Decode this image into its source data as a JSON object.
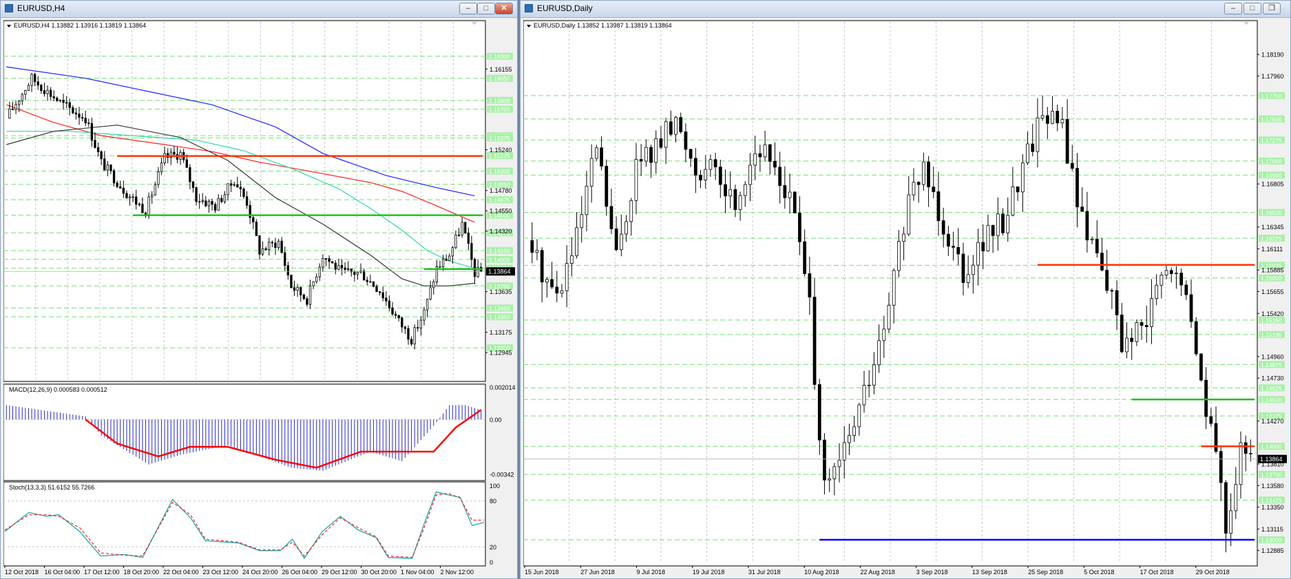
{
  "window_left": {
    "title": "EURUSD,H4"
  },
  "window_right": {
    "title": "EURUSD,Daily"
  },
  "chart_data": [
    {
      "type": "candlestick",
      "symbol_info": "EURUSD,H4  1.13882 1.13916 1.13819 1.13864",
      "ylim": [
        1.1265,
        1.165
      ],
      "y_axis_labels": [
        "1.16155",
        "1.15240",
        "1.14780",
        "1.14550",
        "1.14320",
        "1.13635",
        "1.13175",
        "1.12945"
      ],
      "green_levels": [
        "1.16300",
        "1.16050",
        "1.15800",
        "1.15700",
        "1.15400",
        "1.15375",
        "1.15175",
        "1.15000",
        "1.14850",
        "1.14675",
        "1.14500",
        "1.14300",
        "1.14100",
        "1.14000",
        "1.13900",
        "1.13700",
        "1.13450",
        "1.13350",
        "1.13000"
      ],
      "current_price_label": "1.13864",
      "current_price": 1.13864,
      "x_tick_labels": [
        "12 Oct 2018",
        "16 Oct 04:00",
        "17 Oct 12:00",
        "18 Oct 20:00",
        "22 Oct 04:00",
        "23 Oct 12:00",
        "24 Oct 20:00",
        "26 Oct 04:00",
        "29 Oct 12:00",
        "30 Oct 20:00",
        "1 Nov 04:00",
        "2 Nov 12:00"
      ],
      "support_resistance": [
        {
          "price": 1.1517,
          "color": "#ff3300",
          "from_idx": 35,
          "to_idx": 155
        },
        {
          "price": 1.145,
          "color": "#20c020",
          "from_idx": 40,
          "to_idx": 155
        },
        {
          "price": 1.1389,
          "color": "#20c020",
          "from_idx": 132,
          "to_idx": 155
        }
      ],
      "moving_averages": [
        {
          "color": "#2020ff",
          "points": [
            [
              0,
              1.1618
            ],
            [
              25,
              1.1605
            ],
            [
              45,
              1.159
            ],
            [
              65,
              1.1575
            ],
            [
              85,
              1.155
            ],
            [
              100,
              1.152
            ],
            [
              120,
              1.1495
            ],
            [
              135,
              1.1482
            ],
            [
              148,
              1.1472
            ]
          ]
        },
        {
          "color": "#ff2020",
          "points": [
            [
              0,
              1.1575
            ],
            [
              15,
              1.1555
            ],
            [
              30,
              1.154
            ],
            [
              50,
              1.153
            ],
            [
              65,
              1.1522
            ],
            [
              80,
              1.151
            ],
            [
              100,
              1.1497
            ],
            [
              115,
              1.1487
            ],
            [
              125,
              1.1477
            ],
            [
              135,
              1.1462
            ],
            [
              148,
              1.1442
            ]
          ]
        },
        {
          "color": "#30d8a8",
          "points": [
            [
              0,
              1.1545
            ],
            [
              20,
              1.1545
            ],
            [
              40,
              1.154
            ],
            [
              60,
              1.1535
            ],
            [
              75,
              1.1523
            ],
            [
              90,
              1.1503
            ],
            [
              105,
              1.148
            ],
            [
              115,
              1.1458
            ],
            [
              125,
              1.1433
            ],
            [
              133,
              1.141
            ],
            [
              140,
              1.1398
            ],
            [
              148,
              1.139
            ]
          ]
        },
        {
          "color": "#333333",
          "points": [
            [
              0,
              1.153
            ],
            [
              15,
              1.1545
            ],
            [
              35,
              1.1552
            ],
            [
              55,
              1.1538
            ],
            [
              70,
              1.1512
            ],
            [
              85,
              1.147
            ],
            [
              100,
              1.144
            ],
            [
              115,
              1.1405
            ],
            [
              125,
              1.1378
            ],
            [
              132,
              1.137
            ],
            [
              140,
              1.137
            ],
            [
              148,
              1.1373
            ]
          ]
        }
      ],
      "candle_anchors": [
        [
          0,
          1.156
        ],
        [
          8,
          1.1605
        ],
        [
          18,
          1.1575
        ],
        [
          25,
          1.156
        ],
        [
          30,
          1.151
        ],
        [
          38,
          1.1475
        ],
        [
          44,
          1.1455
        ],
        [
          50,
          1.1515
        ],
        [
          55,
          1.152
        ],
        [
          60,
          1.147
        ],
        [
          66,
          1.146
        ],
        [
          72,
          1.149
        ],
        [
          76,
          1.1465
        ],
        [
          80,
          1.141
        ],
        [
          86,
          1.142
        ],
        [
          90,
          1.137
        ],
        [
          95,
          1.1355
        ],
        [
          100,
          1.1405
        ],
        [
          106,
          1.1385
        ],
        [
          112,
          1.1385
        ],
        [
          118,
          1.1365
        ],
        [
          124,
          1.133
        ],
        [
          128,
          1.131
        ],
        [
          132,
          1.134
        ],
        [
          136,
          1.139
        ],
        [
          140,
          1.1405
        ],
        [
          144,
          1.144
        ],
        [
          148,
          1.1385
        ],
        [
          150,
          1.1386
        ]
      ],
      "macd": {
        "label": "MACD(12,26,9) 0.000583 0.000512",
        "ylim": [
          -0.0038,
          0.0022
        ],
        "axis_labels": [
          "0.002014",
          "0.00",
          "-0.00342"
        ],
        "hist_anchors": [
          [
            0,
            0.0009
          ],
          [
            25,
            0.0002
          ],
          [
            30,
            -0.001
          ],
          [
            45,
            -0.0028
          ],
          [
            55,
            -0.0022
          ],
          [
            70,
            -0.0016
          ],
          [
            90,
            -0.003
          ],
          [
            100,
            -0.0032
          ],
          [
            115,
            -0.002
          ],
          [
            125,
            -0.0026
          ],
          [
            135,
            -0.0004
          ],
          [
            140,
            0.0009
          ],
          [
            145,
            0.0009
          ],
          [
            150,
            0.0006
          ]
        ],
        "signal_anchors": [
          [
            25,
            0.0
          ],
          [
            35,
            -0.0015
          ],
          [
            48,
            -0.0023
          ],
          [
            58,
            -0.0017
          ],
          [
            70,
            -0.0017
          ],
          [
            85,
            -0.0025
          ],
          [
            98,
            -0.003
          ],
          [
            112,
            -0.002
          ],
          [
            125,
            -0.002
          ],
          [
            135,
            -0.002
          ],
          [
            142,
            -0.0005
          ],
          [
            150,
            0.0006
          ]
        ]
      },
      "stoch": {
        "label": "Stoch(13,3,3) 51.6152 55.7266",
        "ylim": [
          -5,
          105
        ],
        "axis_labels": [
          "100",
          "80",
          "20",
          "0"
        ],
        "main_anchors": [
          [
            0,
            40
          ],
          [
            8,
            65
          ],
          [
            14,
            60
          ],
          [
            18,
            62
          ],
          [
            25,
            40
          ],
          [
            32,
            8
          ],
          [
            40,
            10
          ],
          [
            46,
            6
          ],
          [
            56,
            82
          ],
          [
            62,
            58
          ],
          [
            67,
            28
          ],
          [
            78,
            25
          ],
          [
            85,
            15
          ],
          [
            92,
            15
          ],
          [
            96,
            30
          ],
          [
            100,
            5
          ],
          [
            106,
            40
          ],
          [
            112,
            60
          ],
          [
            118,
            42
          ],
          [
            124,
            32
          ],
          [
            128,
            6
          ],
          [
            136,
            5
          ],
          [
            140,
            50
          ],
          [
            144,
            92
          ],
          [
            148,
            88
          ],
          [
            152,
            85
          ],
          [
            156,
            48
          ],
          [
            160,
            52
          ]
        ],
        "signal_anchors": [
          [
            0,
            42
          ],
          [
            8,
            62
          ],
          [
            14,
            62
          ],
          [
            18,
            60
          ],
          [
            25,
            45
          ],
          [
            32,
            12
          ],
          [
            40,
            9
          ],
          [
            46,
            8
          ],
          [
            56,
            78
          ],
          [
            62,
            62
          ],
          [
            67,
            30
          ],
          [
            78,
            26
          ],
          [
            85,
            16
          ],
          [
            92,
            16
          ],
          [
            96,
            26
          ],
          [
            100,
            8
          ],
          [
            106,
            36
          ],
          [
            112,
            58
          ],
          [
            118,
            45
          ],
          [
            124,
            33
          ],
          [
            128,
            8
          ],
          [
            136,
            6
          ],
          [
            140,
            45
          ],
          [
            144,
            88
          ],
          [
            148,
            90
          ],
          [
            152,
            84
          ],
          [
            156,
            55
          ],
          [
            160,
            55
          ]
        ]
      }
    },
    {
      "type": "candlestick",
      "symbol_info": "EURUSD,Daily  1.13852 1.13987 1.13819 1.13864",
      "ylim": [
        1.1275,
        1.1836
      ],
      "y_axis_labels": [
        "1.18190",
        "1.17960",
        "1.16805",
        "1.16345",
        "1.16111",
        "1.15885",
        "1.15655",
        "1.15420",
        "1.14960",
        "1.14730",
        "1.14270",
        "1.13810",
        "1.13580",
        "1.13350",
        "1.13115",
        "1.12885"
      ],
      "green_levels": [
        "1.17750",
        "1.17500",
        "1.17275",
        "1.17050",
        "1.16900",
        "1.16500",
        "1.16225",
        "1.15935",
        "1.15800",
        "1.15350",
        "1.15195",
        "1.14875",
        "1.14625",
        "1.14500",
        "1.14325",
        "1.14000",
        "1.13700",
        "1.13425",
        "1.13000"
      ],
      "current_price_label": "1.13864",
      "current_price": 1.13864,
      "x_tick_labels": [
        "15 Jun 2018",
        "27 Jun 2018",
        "9 Jul 2018",
        "19 Jul 2018",
        "31 Jul 2018",
        "10 Aug 2018",
        "22 Aug 2018",
        "3 Sep 2018",
        "13 Sep 2018",
        "25 Sep 2018",
        "5 Oct 2018",
        "17 Oct 2018",
        "29 Oct 2018"
      ],
      "support_resistance": [
        {
          "price": 1.1594,
          "color": "#ff3300",
          "from_idx": 103,
          "to_idx": 148
        },
        {
          "price": 1.145,
          "color": "#20c020",
          "from_idx": 122,
          "to_idx": 148
        },
        {
          "price": 1.14,
          "color": "#ff3300",
          "from_idx": 136,
          "to_idx": 148
        },
        {
          "price": 1.13,
          "color": "#0000ff",
          "from_idx": 59,
          "to_idx": 148
        }
      ],
      "candle_anchors": [
        [
          0,
          1.162
        ],
        [
          6,
          1.156
        ],
        [
          10,
          1.162
        ],
        [
          14,
          1.172
        ],
        [
          18,
          1.16
        ],
        [
          22,
          1.17
        ],
        [
          26,
          1.172
        ],
        [
          30,
          1.1745
        ],
        [
          34,
          1.17
        ],
        [
          38,
          1.169
        ],
        [
          42,
          1.166
        ],
        [
          46,
          1.172
        ],
        [
          50,
          1.17
        ],
        [
          54,
          1.165
        ],
        [
          57,
          1.1545
        ],
        [
          60,
          1.135
        ],
        [
          63,
          1.138
        ],
        [
          67,
          1.144
        ],
        [
          72,
          1.152
        ],
        [
          76,
          1.164
        ],
        [
          80,
          1.17
        ],
        [
          84,
          1.164
        ],
        [
          88,
          1.159
        ],
        [
          92,
          1.162
        ],
        [
          96,
          1.164
        ],
        [
          100,
          1.17
        ],
        [
          104,
          1.176
        ],
        [
          108,
          1.174
        ],
        [
          112,
          1.164
        ],
        [
          116,
          1.16
        ],
        [
          120,
          1.151
        ],
        [
          124,
          1.152
        ],
        [
          128,
          1.158
        ],
        [
          132,
          1.158
        ],
        [
          135,
          1.15
        ],
        [
          138,
          1.142
        ],
        [
          141,
          1.132
        ],
        [
          144,
          1.139
        ],
        [
          146,
          1.1386
        ]
      ]
    }
  ]
}
